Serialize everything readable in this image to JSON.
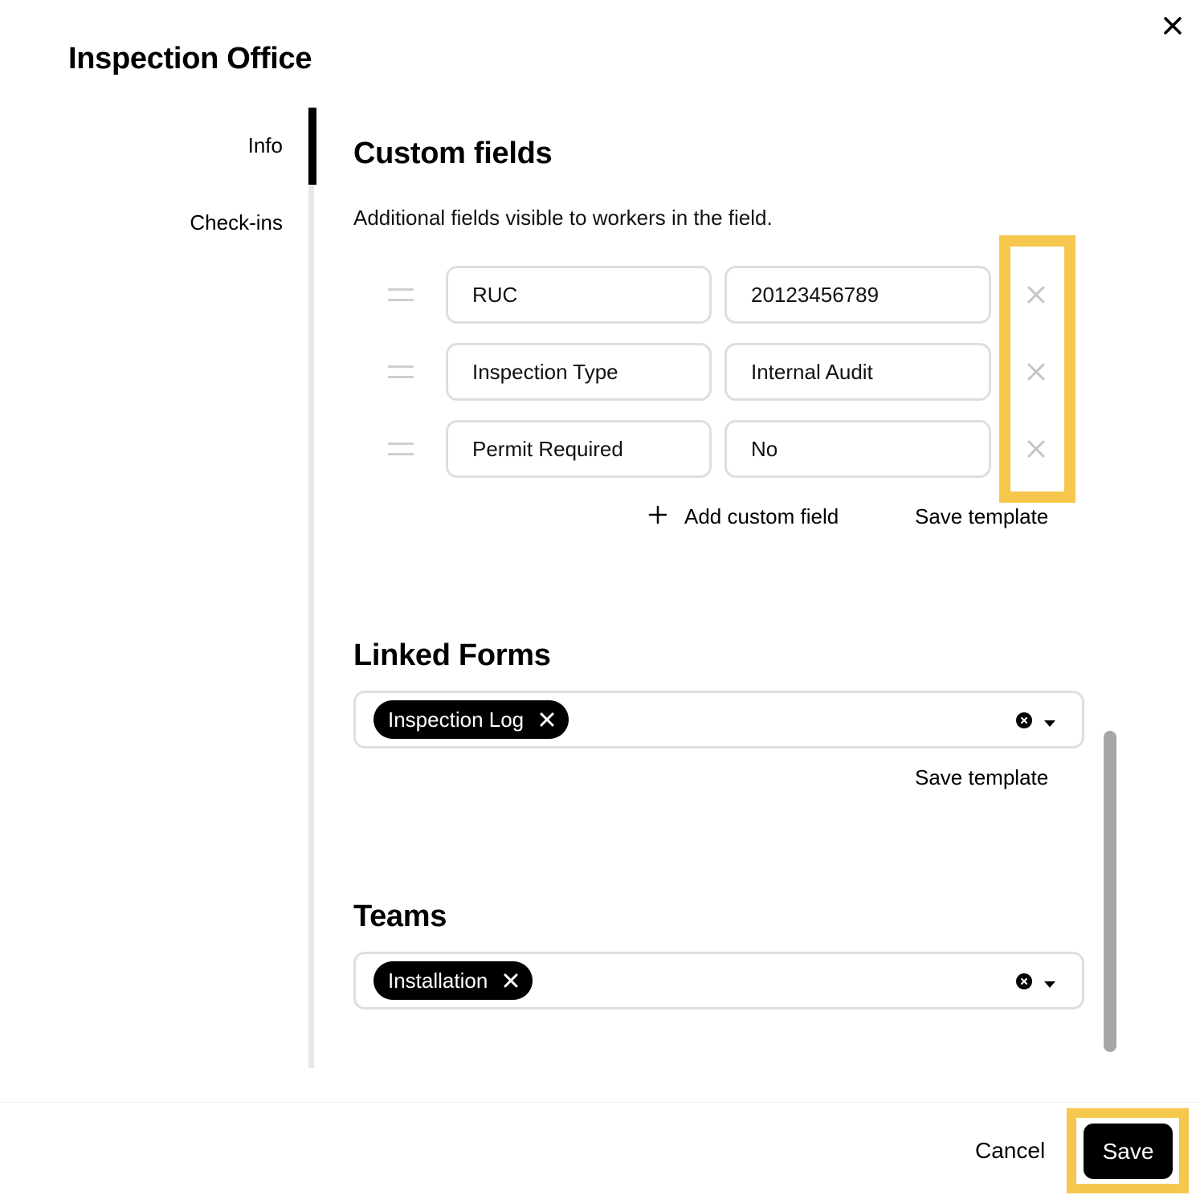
{
  "dialog": {
    "title": "Inspection Office",
    "close_icon": "close-icon"
  },
  "nav": {
    "items": [
      {
        "label": "Info",
        "active": true
      },
      {
        "label": "Check-ins",
        "active": false
      }
    ]
  },
  "custom_fields": {
    "title": "Custom fields",
    "description": "Additional fields visible to workers in the field.",
    "rows": [
      {
        "name": "RUC",
        "value": "20123456789"
      },
      {
        "name": "Inspection Type",
        "value": "Internal Audit"
      },
      {
        "name": "Permit Required",
        "value": "No"
      }
    ],
    "add_label": "Add custom field",
    "save_template_label": "Save template"
  },
  "linked_forms": {
    "title": "Linked Forms",
    "selected": [
      "Inspection Log"
    ],
    "save_template_label": "Save template"
  },
  "teams": {
    "title": "Teams",
    "selected": [
      "Installation"
    ]
  },
  "footer": {
    "cancel_label": "Cancel",
    "save_label": "Save"
  },
  "colors": {
    "highlight": "#f5c74d",
    "primary": "#000000",
    "border": "#dedede"
  }
}
